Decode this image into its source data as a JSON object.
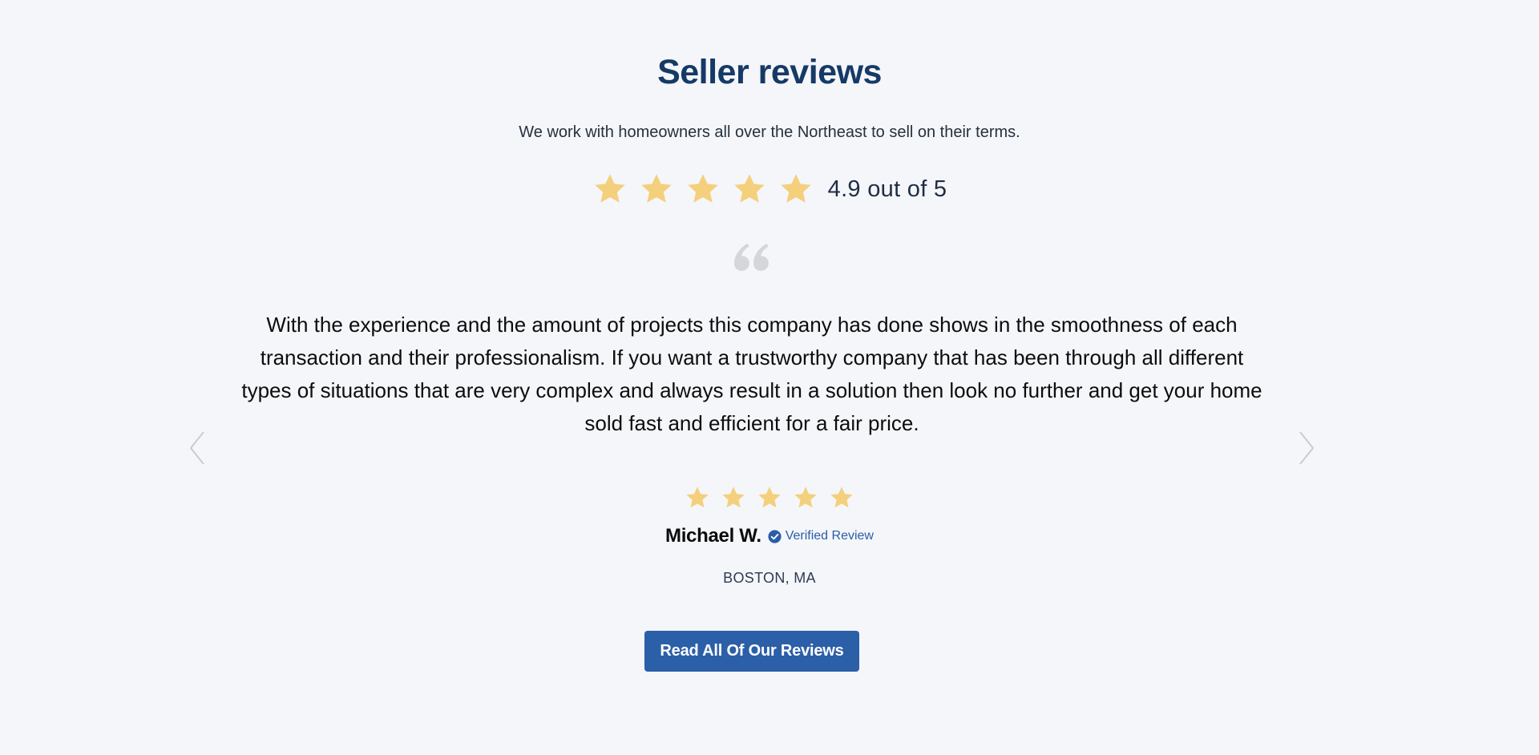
{
  "section": {
    "title": "Seller reviews",
    "subtitle": "We work with homeowners all over the Northeast to sell on their terms."
  },
  "overall_rating": {
    "stars": 5,
    "text": "4.9 out of 5",
    "star_color": "#f4d07d"
  },
  "quote_icon": "quote-icon",
  "carousel": {
    "prev_icon": "chevron-left-icon",
    "next_icon": "chevron-right-icon",
    "review": {
      "text": "With the experience and the amount of projects this company has done shows in the smoothness of each transaction and their professionalism. If you want a trustworthy company that has been through all different types of situations that are very complex and always result in a solution then look no further and get your home sold fast and efficient for a fair price.",
      "stars": 5,
      "author": "Michael W.",
      "verified_label": "Verified Review",
      "verified_icon": "verified-check-icon",
      "location": "BOSTON, MA"
    }
  },
  "cta": {
    "label": "Read All Of Our Reviews"
  },
  "colors": {
    "background": "#f5f6fa",
    "title": "#163a66",
    "accent": "#2b5fa8",
    "star": "#f4d07d",
    "arrow": "#c9ccd2",
    "quote": "#d4d6da"
  }
}
